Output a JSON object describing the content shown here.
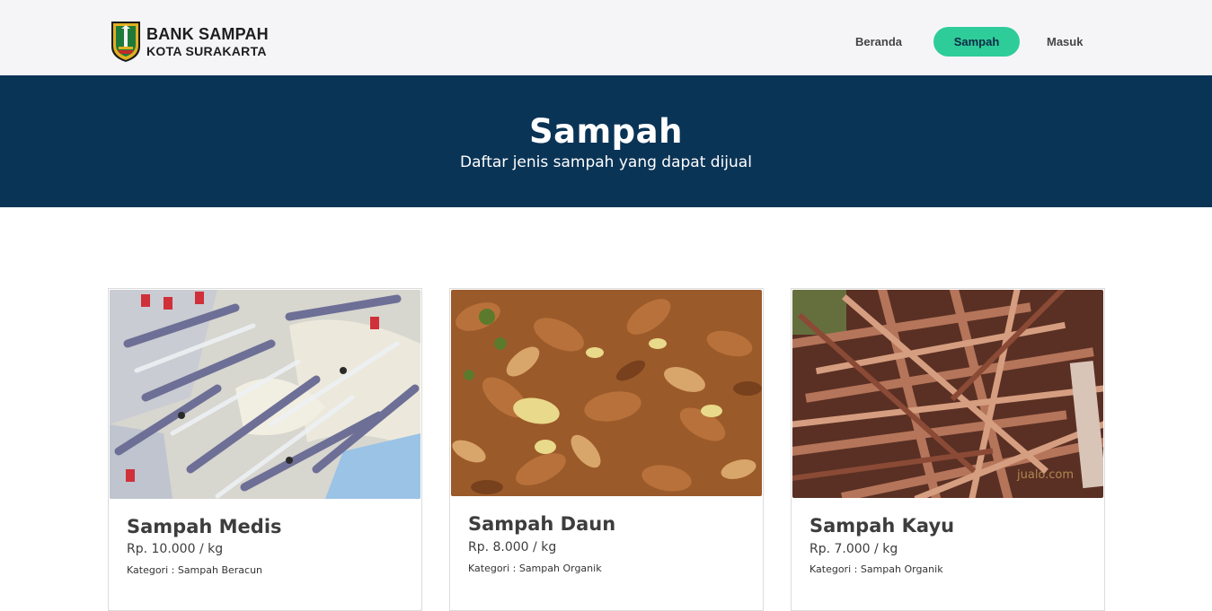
{
  "brand": {
    "line1": "BANK SAMPAH",
    "line2": "KOTA SURAKARTA"
  },
  "nav": {
    "items": [
      {
        "label": "Beranda",
        "active": false
      },
      {
        "label": "Sampah",
        "active": true
      },
      {
        "label": "Masuk",
        "active": false
      }
    ]
  },
  "hero": {
    "title": "Sampah",
    "subtitle": "Daftar jenis sampah yang dapat dijual"
  },
  "cards": [
    {
      "title": "Sampah Medis",
      "price": "Rp. 10.000 / kg",
      "category": "Kategori : Sampah Beracun",
      "image": "medical-waste-photo"
    },
    {
      "title": "Sampah Daun",
      "price": "Rp. 8.000 / kg",
      "category": "Kategori : Sampah Organik",
      "image": "leaves-photo"
    },
    {
      "title": "Sampah Kayu",
      "price": "Rp. 7.000 / kg",
      "category": "Kategori : Sampah Organik",
      "image": "wood-photo"
    }
  ],
  "colors": {
    "accent": "#2ecc99",
    "hero_bg": "#0a3456",
    "nav_bg": "#f5f5f8"
  }
}
